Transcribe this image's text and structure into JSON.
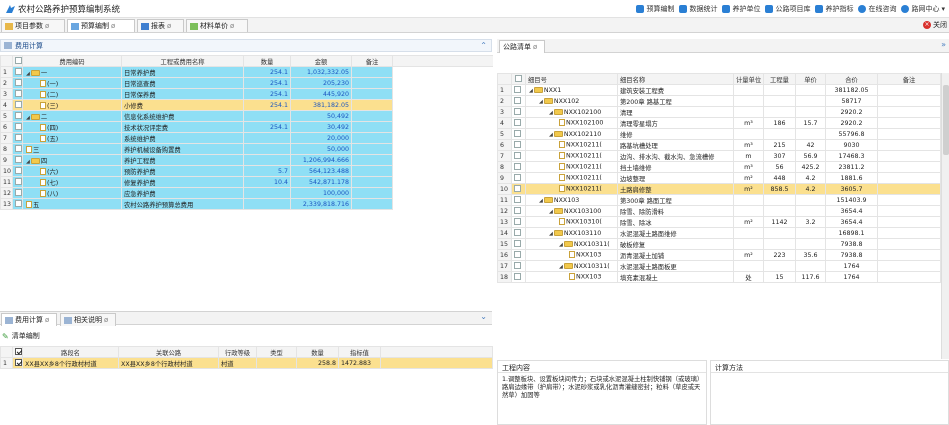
{
  "app": {
    "title": "农村公路养护预算编制系统",
    "menus": [
      "预算编制",
      "数据统计",
      "养护单位",
      "公路项目库",
      "养护指标",
      "在线咨询",
      "路网中心"
    ],
    "close_label": "关闭"
  },
  "tabs": [
    {
      "label": "项目参数",
      "active": false
    },
    {
      "label": "预算编制",
      "active": true
    },
    {
      "label": "报表",
      "active": false
    },
    {
      "label": "材料单价",
      "active": false
    }
  ],
  "fee_panel": {
    "title": "费用计算",
    "columns": [
      "",
      "费用编码",
      "工程或费用名称",
      "数量",
      "金额",
      "备注"
    ],
    "rows": [
      {
        "n": "1",
        "code": "一",
        "name": "日常养护费",
        "qty": "254.1",
        "amt": "1,032,332.05",
        "style": "blue",
        "icon": "folder",
        "indent": 0
      },
      {
        "n": "2",
        "code": "(一)",
        "name": "日常巡查费",
        "qty": "254.1",
        "amt": "205,230",
        "style": "blue",
        "icon": "file",
        "indent": 1
      },
      {
        "n": "3",
        "code": "(二)",
        "name": "日常保养费",
        "qty": "254.1",
        "amt": "445,920",
        "style": "blue",
        "icon": "file",
        "indent": 1
      },
      {
        "n": "4",
        "code": "(三)",
        "name": "小修费",
        "qty": "254.1",
        "amt": "381,182.05",
        "style": "orange",
        "icon": "file",
        "indent": 1
      },
      {
        "n": "5",
        "code": "二",
        "name": "信息化系统维护费",
        "qty": "",
        "amt": "50,492",
        "style": "blue",
        "icon": "folder",
        "indent": 0
      },
      {
        "n": "6",
        "code": "(四)",
        "name": "技术状况评定费",
        "qty": "254.1",
        "amt": "30,492",
        "style": "blue",
        "icon": "file",
        "indent": 1
      },
      {
        "n": "7",
        "code": "(五)",
        "name": "系统维护费",
        "qty": "",
        "amt": "20,000",
        "style": "blue",
        "icon": "file",
        "indent": 1
      },
      {
        "n": "8",
        "code": "三",
        "name": "养护机械设备购置费",
        "qty": "",
        "amt": "50,000",
        "style": "blue",
        "icon": "file",
        "indent": 0
      },
      {
        "n": "9",
        "code": "四",
        "name": "养护工程费",
        "qty": "",
        "amt": "1,206,994.666",
        "style": "blue",
        "icon": "folder",
        "indent": 0
      },
      {
        "n": "10",
        "code": "(六)",
        "name": "预防养护费",
        "qty": "5.7",
        "amt": "564,123.488",
        "style": "blue",
        "icon": "file",
        "indent": 1
      },
      {
        "n": "11",
        "code": "(七)",
        "name": "修复养护费",
        "qty": "10.4",
        "amt": "542,871.178",
        "style": "blue",
        "icon": "file",
        "indent": 1
      },
      {
        "n": "12",
        "code": "(八)",
        "name": "应急养护费",
        "qty": "",
        "amt": "100,000",
        "style": "blue",
        "icon": "file",
        "indent": 1
      },
      {
        "n": "13",
        "code": "五",
        "name": "农村公路养护预算总费用",
        "qty": "",
        "amt": "2,339,818.716",
        "style": "blue",
        "icon": "file",
        "indent": 0
      }
    ]
  },
  "bottom_tabs": [
    "费用计算",
    "相关说明"
  ],
  "list_panel": {
    "tool_label": "清单编制",
    "columns": [
      "",
      "路段名",
      "关联公路",
      "行政等级",
      "类型",
      "数量",
      "指标值"
    ],
    "rows": [
      {
        "n": "1",
        "name": "XX县XX乡8个行政村村道",
        "road": "XX县XX乡8个行政村村道",
        "level": "村道",
        "type": "",
        "qty": "258.8",
        "val": "1472.883"
      }
    ]
  },
  "road_panel": {
    "tab": "公路清单",
    "columns": [
      "",
      "细目号",
      "细目名称",
      "计量单位",
      "工程量",
      "单价",
      "合价",
      "备注"
    ],
    "rows": [
      {
        "n": "1",
        "code": "NXX1",
        "name": "建筑安装工程费",
        "unit": "",
        "qty": "",
        "price": "",
        "total": "381182.05",
        "icon": "folder",
        "indent": 0
      },
      {
        "n": "2",
        "code": "NXX102",
        "name": "第200章 路基工程",
        "unit": "",
        "qty": "",
        "price": "",
        "total": "58717",
        "icon": "folder",
        "indent": 1
      },
      {
        "n": "3",
        "code": "NXX102100",
        "name": "清理",
        "unit": "",
        "qty": "",
        "price": "",
        "total": "2920.2",
        "icon": "folder",
        "indent": 2
      },
      {
        "n": "4",
        "code": "NXX102100",
        "name": "清理零星塌方",
        "unit": "m³",
        "qty": "186",
        "price": "15.7",
        "total": "2920.2",
        "icon": "file",
        "indent": 3
      },
      {
        "n": "5",
        "code": "NXX102110",
        "name": "维修",
        "unit": "",
        "qty": "",
        "price": "",
        "total": "55796.8",
        "icon": "folder",
        "indent": 2
      },
      {
        "n": "6",
        "code": "NXX10211(",
        "name": "路基坑槽处理",
        "unit": "m³",
        "qty": "215",
        "price": "42",
        "total": "9030",
        "icon": "file",
        "indent": 3
      },
      {
        "n": "7",
        "code": "NXX10211(",
        "name": "边沟、排水沟、截水沟、急流槽修",
        "unit": "m",
        "qty": "307",
        "price": "56.9",
        "total": "17468.3",
        "icon": "file",
        "indent": 3
      },
      {
        "n": "8",
        "code": "NXX10211(",
        "name": "挡土墙维修",
        "unit": "m³",
        "qty": "56",
        "price": "425.2",
        "total": "23811.2",
        "icon": "file",
        "indent": 3
      },
      {
        "n": "9",
        "code": "NXX10211(",
        "name": "边坡整理",
        "unit": "m²",
        "qty": "448",
        "price": "4.2",
        "total": "1881.6",
        "icon": "file",
        "indent": 3
      },
      {
        "n": "10",
        "code": "NXX10211(",
        "name": "土路肩修整",
        "unit": "m²",
        "qty": "858.5",
        "price": "4.2",
        "total": "3605.7",
        "icon": "file",
        "indent": 3,
        "selected": true
      },
      {
        "n": "11",
        "code": "NXX103",
        "name": "第300章 路面工程",
        "unit": "",
        "qty": "",
        "price": "",
        "total": "151403.9",
        "icon": "folder",
        "indent": 1
      },
      {
        "n": "12",
        "code": "NXX103100",
        "name": "除雪、除防滑料",
        "unit": "",
        "qty": "",
        "price": "",
        "total": "3654.4",
        "icon": "folder",
        "indent": 2
      },
      {
        "n": "13",
        "code": "NXX10310(",
        "name": "除雪、除冰",
        "unit": "m²",
        "qty": "1142",
        "price": "3.2",
        "total": "3654.4",
        "icon": "file",
        "indent": 3
      },
      {
        "n": "14",
        "code": "NXX103110",
        "name": "水泥混凝土路面维修",
        "unit": "",
        "qty": "",
        "price": "",
        "total": "16898.1",
        "icon": "folder",
        "indent": 2
      },
      {
        "n": "15",
        "code": "NXX10311(",
        "name": "破板修复",
        "unit": "",
        "qty": "",
        "price": "",
        "total": "7938.8",
        "icon": "folder",
        "indent": 3
      },
      {
        "n": "16",
        "code": "NXX103",
        "name": "沥青混凝土加铺",
        "unit": "m²",
        "qty": "223",
        "price": "35.6",
        "total": "7938.8",
        "icon": "file",
        "indent": 4
      },
      {
        "n": "17",
        "code": "NXX10311(",
        "name": "水泥混凝土路面板更",
        "unit": "",
        "qty": "",
        "price": "",
        "total": "1764",
        "icon": "folder",
        "indent": 3
      },
      {
        "n": "18",
        "code": "NXX103",
        "name": "填充素混凝土",
        "unit": "处",
        "qty": "15",
        "price": "117.6",
        "total": "1764",
        "icon": "file",
        "indent": 4
      }
    ]
  },
  "work_panel": {
    "title": "工程内容",
    "text": "1.调整板块、设置板块间传力；石块或水泥混凝土柱制快铺钢（或玻璃）路肩边缘带（护肩带）；水泥砂浆或乳化沥青灌缝密封；粒料（草皮或天然草）加固等"
  },
  "calc_panel": {
    "title": "计算方法"
  }
}
